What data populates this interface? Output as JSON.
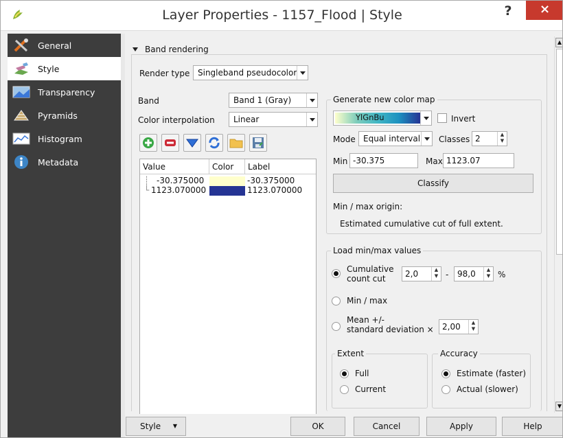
{
  "window": {
    "title": "Layer Properties - 1157_Flood | Style",
    "help": "?",
    "close": "×"
  },
  "sidebar": {
    "items": [
      {
        "label": "General",
        "icon": "tools-icon"
      },
      {
        "label": "Style",
        "icon": "paint-brush-icon"
      },
      {
        "label": "Transparency",
        "icon": "transparency-icon"
      },
      {
        "label": "Pyramids",
        "icon": "pyramid-icon"
      },
      {
        "label": "Histogram",
        "icon": "histogram-icon"
      },
      {
        "label": "Metadata",
        "icon": "info-icon"
      }
    ]
  },
  "band_rendering": {
    "title": "Band rendering",
    "render_type_label": "Render type",
    "render_type_value": "Singleband pseudocolor",
    "band_label": "Band",
    "band_value": "Band 1 (Gray)",
    "interp_label": "Color interpolation",
    "interp_value": "Linear",
    "table": {
      "headers": [
        "Value",
        "Color",
        "Label"
      ],
      "rows": [
        {
          "value": "-30.375000",
          "color": "#ffffcc",
          "label": "-30.375000"
        },
        {
          "value": "1123.070000",
          "color": "#253494",
          "label": "1123.070000"
        }
      ]
    }
  },
  "color_map": {
    "title": "Generate new color map",
    "ramp": "YlGnBu",
    "invert_label": "Invert",
    "mode_label": "Mode",
    "mode_value": "Equal interval",
    "classes_label": "Classes",
    "classes_value": "2",
    "min_label": "Min",
    "min_value": "-30.375",
    "max_label": "Max",
    "max_value": "1123.07",
    "classify_label": "Classify",
    "origin_label": "Min / max origin:",
    "origin_value": "Estimated cumulative cut of full extent."
  },
  "minmax": {
    "title": "Load min/max values",
    "cumulative_label_1": "Cumulative",
    "cumulative_label_2": "count cut",
    "cut_low": "2,0",
    "dash": "-",
    "cut_high": "98,0",
    "percent": "%",
    "minmax_label": "Min / max",
    "mean_label_1": "Mean +/-",
    "mean_label_2": "standard deviation ×",
    "stddev_value": "2,00",
    "extent_title": "Extent",
    "extent_full": "Full",
    "extent_current": "Current",
    "accuracy_title": "Accuracy",
    "accuracy_estimate": "Estimate (faster)",
    "accuracy_actual": "Actual (slower)"
  },
  "footer": {
    "style": "Style",
    "ok": "OK",
    "cancel": "Cancel",
    "apply": "Apply",
    "help": "Help"
  },
  "colors": {
    "sidebar_bg": "#3d3d3d",
    "close_red": "#c7392d",
    "ramp_low": "#ffffcc",
    "ramp_high": "#253494"
  }
}
